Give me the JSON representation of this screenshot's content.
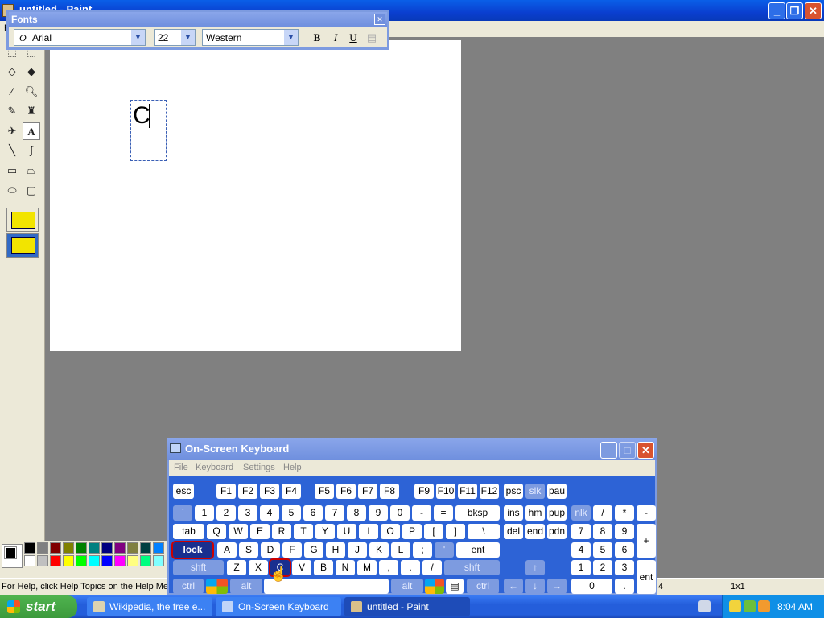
{
  "window": {
    "title": "untitled - Paint",
    "menu_first": "F"
  },
  "fonts_toolbar": {
    "title": "Fonts",
    "font": "Arial",
    "size": "22",
    "script": "Western",
    "bold": "B",
    "italic": "I",
    "underline": "U"
  },
  "canvas": {
    "text": "C"
  },
  "statusbar": {
    "help": "For Help, click Help Topics on the Help Menu.",
    "coords": "4",
    "size": "1x1"
  },
  "osk": {
    "title": "On-Screen Keyboard",
    "menus": [
      "File",
      "Keyboard",
      "Settings",
      "Help"
    ],
    "keys": {
      "esc": "esc",
      "f1": "F1",
      "f2": "F2",
      "f3": "F3",
      "f4": "F4",
      "f5": "F5",
      "f6": "F6",
      "f7": "F7",
      "f8": "F8",
      "f9": "F9",
      "f10": "F10",
      "f11": "F11",
      "f12": "F12",
      "psc": "psc",
      "slk": "slk",
      "pau": "pau",
      "backtick": "`",
      "n1": "1",
      "n2": "2",
      "n3": "3",
      "n4": "4",
      "n5": "5",
      "n6": "6",
      "n7": "7",
      "n8": "8",
      "n9": "9",
      "n0": "0",
      "minus": "-",
      "equals": "=",
      "bksp": "bksp",
      "ins": "ins",
      "hm": "hm",
      "pup": "pup",
      "nlk": "nlk",
      "np_slash": "/",
      "np_star": "*",
      "np_minus": "-",
      "tab": "tab",
      "q": "Q",
      "w": "W",
      "e": "E",
      "r": "R",
      "t": "T",
      "y": "Y",
      "u": "U",
      "i": "I",
      "o": "O",
      "p": "P",
      "lbr": "[",
      "rbr": "]",
      "bslash": "\\",
      "del": "del",
      "end": "end",
      "pdn": "pdn",
      "np7": "7",
      "np8": "8",
      "np9": "9",
      "np_plus": "+",
      "lock": "lock",
      "a": "A",
      "s": "S",
      "d": "D",
      "f": "F",
      "g": "G",
      "h": "H",
      "j": "J",
      "k": "K",
      "l": "L",
      "semi": ";",
      "quote": "'",
      "ent": "ent",
      "np4": "4",
      "np5": "5",
      "np6": "6",
      "shft_l": "shft",
      "z": "Z",
      "x": "X",
      "c": "C",
      "v": "V",
      "b": "B",
      "n": "N",
      "m": "M",
      "comma": ",",
      "period": ".",
      "slash": "/",
      "shft_r": "shft",
      "up": "↑",
      "np1": "1",
      "np2": "2",
      "np3": "3",
      "np_ent": "ent",
      "ctrl_l": "ctrl",
      "alt_l": "alt",
      "alt_r": "alt",
      "ctrl_r": "ctrl",
      "left": "←",
      "down": "↓",
      "right": "→",
      "np0": "0",
      "np_dot": "."
    }
  },
  "taskbar": {
    "start": "start",
    "tasks": [
      "Wikipedia, the free e...",
      "On-Screen Keyboard",
      "untitled - Paint"
    ],
    "clock": "8:04 AM"
  },
  "colors": {
    "accent": "#245edb",
    "caps_highlight": "#1a2f8f"
  }
}
